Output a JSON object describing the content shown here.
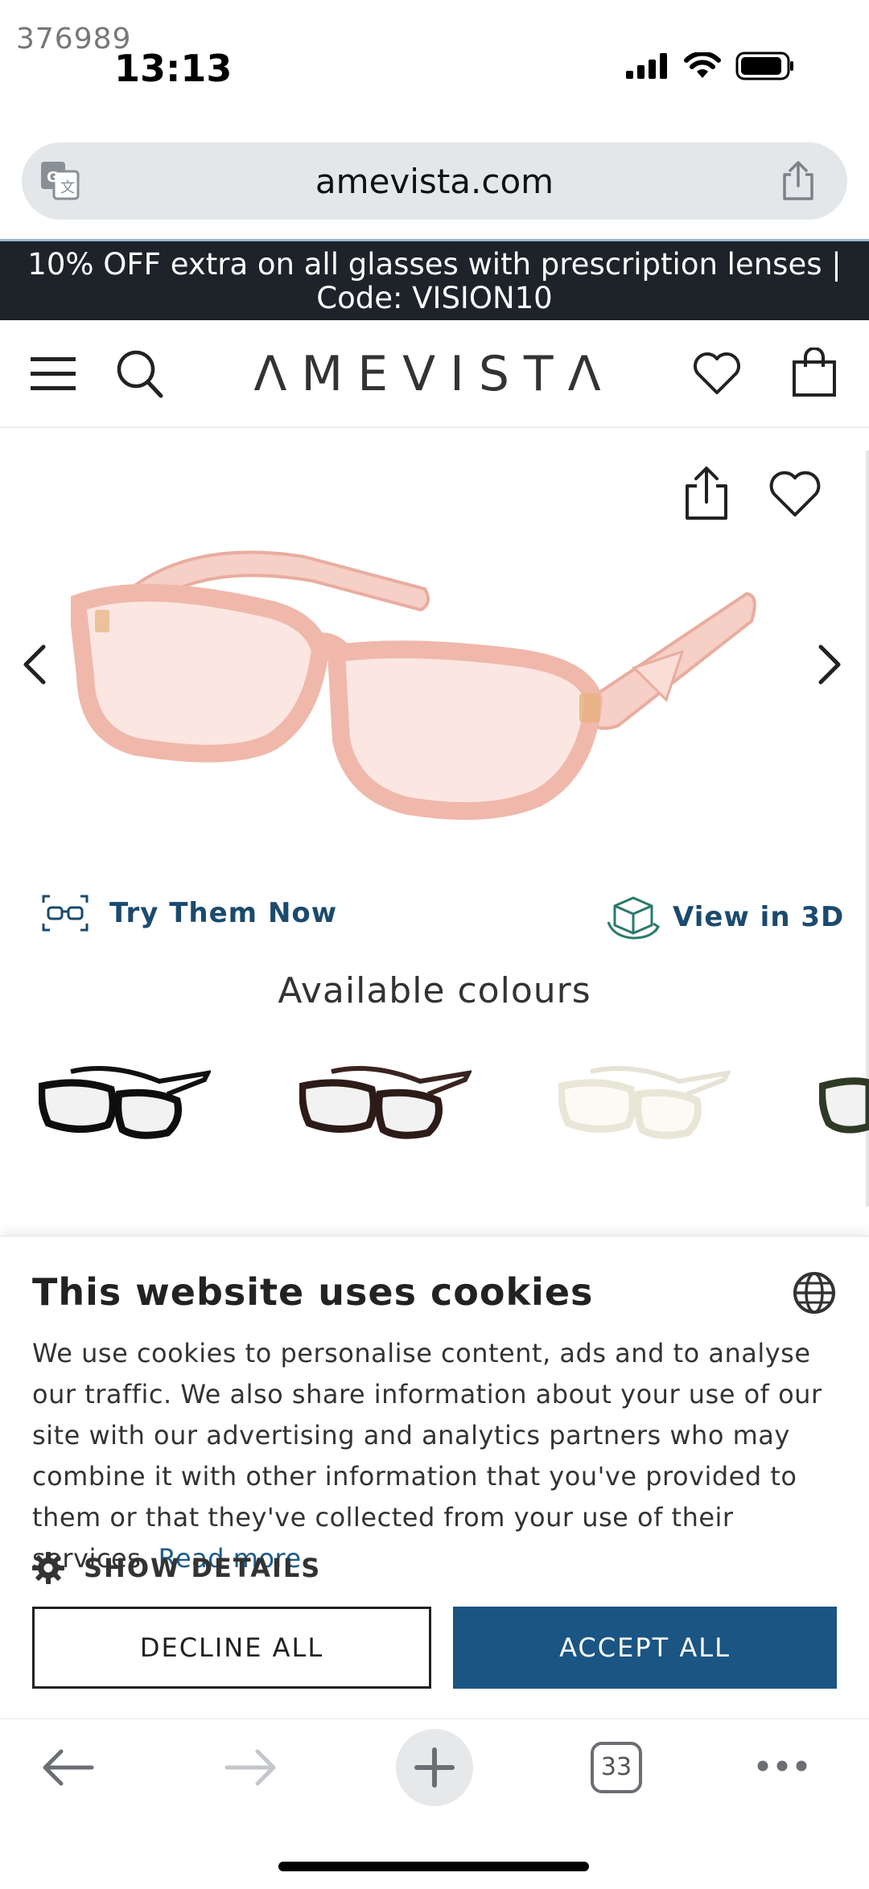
{
  "status_bar": {
    "watermark": "376989",
    "time": "13:13"
  },
  "browser": {
    "url": "amevista.com",
    "tab_count": "33"
  },
  "promo": {
    "line1": "10% OFF extra on all glasses with prescription lenses |",
    "line2": "Code: VISION10"
  },
  "header": {
    "logo": "ΛMEVISTΛ"
  },
  "product": {
    "try_label": "Try Them Now",
    "view3d_label": "View in 3D",
    "colours_title": "Available colours",
    "frame_color": "#f3c1b8"
  },
  "cookie": {
    "title": "This website uses cookies",
    "body": "We use cookies to personalise content, ads and to analyse our traffic. We also share information about your use of our site with our advertising and analytics partners who may combine it with other information that you've provided to them or that they've collected from your use of their services.",
    "read_more": "Read more",
    "show_details": "SHOW DETAILS",
    "decline": "DECLINE ALL",
    "accept": "ACCEPT ALL"
  },
  "colors": {
    "promo_bg": "#1e2329",
    "accent_blue": "#1a5583",
    "link_blue": "#1b4a6e"
  }
}
